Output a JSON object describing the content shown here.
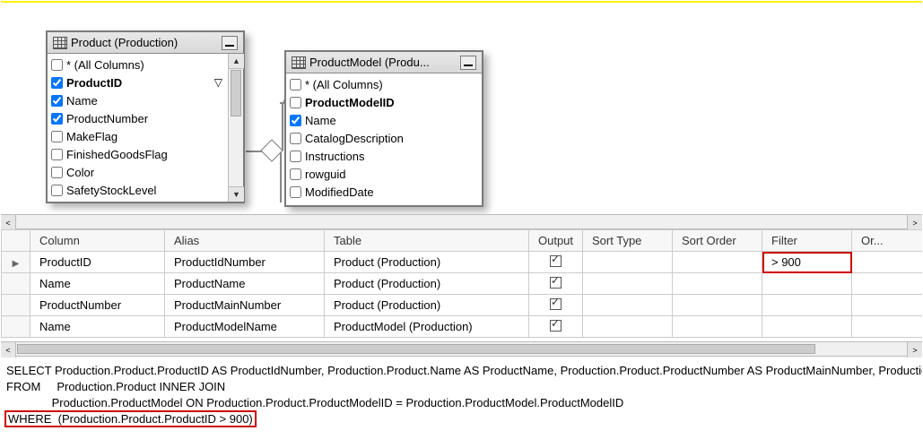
{
  "tables": {
    "product": {
      "title": "Product (Production)",
      "columns": [
        {
          "label": "* (All Columns)",
          "checked": false,
          "bold": false
        },
        {
          "label": "ProductID",
          "checked": true,
          "bold": true,
          "filtered": true
        },
        {
          "label": "Name",
          "checked": true,
          "bold": false
        },
        {
          "label": "ProductNumber",
          "checked": true,
          "bold": false
        },
        {
          "label": "MakeFlag",
          "checked": false,
          "bold": false
        },
        {
          "label": "FinishedGoodsFlag",
          "checked": false,
          "bold": false
        },
        {
          "label": "Color",
          "checked": false,
          "bold": false
        },
        {
          "label": "SafetyStockLevel",
          "checked": false,
          "bold": false
        }
      ]
    },
    "productModel": {
      "title": "ProductModel (Produ...",
      "columns": [
        {
          "label": "* (All Columns)",
          "checked": false,
          "bold": false
        },
        {
          "label": "ProductModelID",
          "checked": false,
          "bold": true
        },
        {
          "label": "Name",
          "checked": true,
          "bold": false
        },
        {
          "label": "CatalogDescription",
          "checked": false,
          "bold": false
        },
        {
          "label": "Instructions",
          "checked": false,
          "bold": false
        },
        {
          "label": "rowguid",
          "checked": false,
          "bold": false
        },
        {
          "label": "ModifiedDate",
          "checked": false,
          "bold": false
        }
      ]
    }
  },
  "criteria": {
    "headers": {
      "column": "Column",
      "alias": "Alias",
      "table": "Table",
      "output": "Output",
      "sortType": "Sort Type",
      "sortOrder": "Sort Order",
      "filter": "Filter",
      "or": "Or..."
    },
    "rows": [
      {
        "column": "ProductID",
        "alias": "ProductIdNumber",
        "table": "Product (Production)",
        "output": true,
        "filter": "> 900"
      },
      {
        "column": "Name",
        "alias": "ProductName",
        "table": "Product (Production)",
        "output": true,
        "filter": ""
      },
      {
        "column": "ProductNumber",
        "alias": "ProductMainNumber",
        "table": "Product (Production)",
        "output": true,
        "filter": ""
      },
      {
        "column": "Name",
        "alias": "ProductModelName",
        "table": "ProductModel (Production)",
        "output": true,
        "filter": ""
      }
    ]
  },
  "sql": {
    "l1": "SELECT Production.Product.ProductID AS ProductIdNumber, Production.Product.Name AS ProductName, Production.Product.ProductNumber AS ProductMainNumber, Production",
    "l2": "FROM     Production.Product INNER JOIN",
    "l3": "              Production.ProductModel ON Production.Product.ProductModelID = Production.ProductModel.ProductModelID",
    "l4a": "WHERE  ",
    "l4b": "(Production.Product.ProductID > 900)"
  },
  "glyphs": {
    "funnel": "▽"
  }
}
